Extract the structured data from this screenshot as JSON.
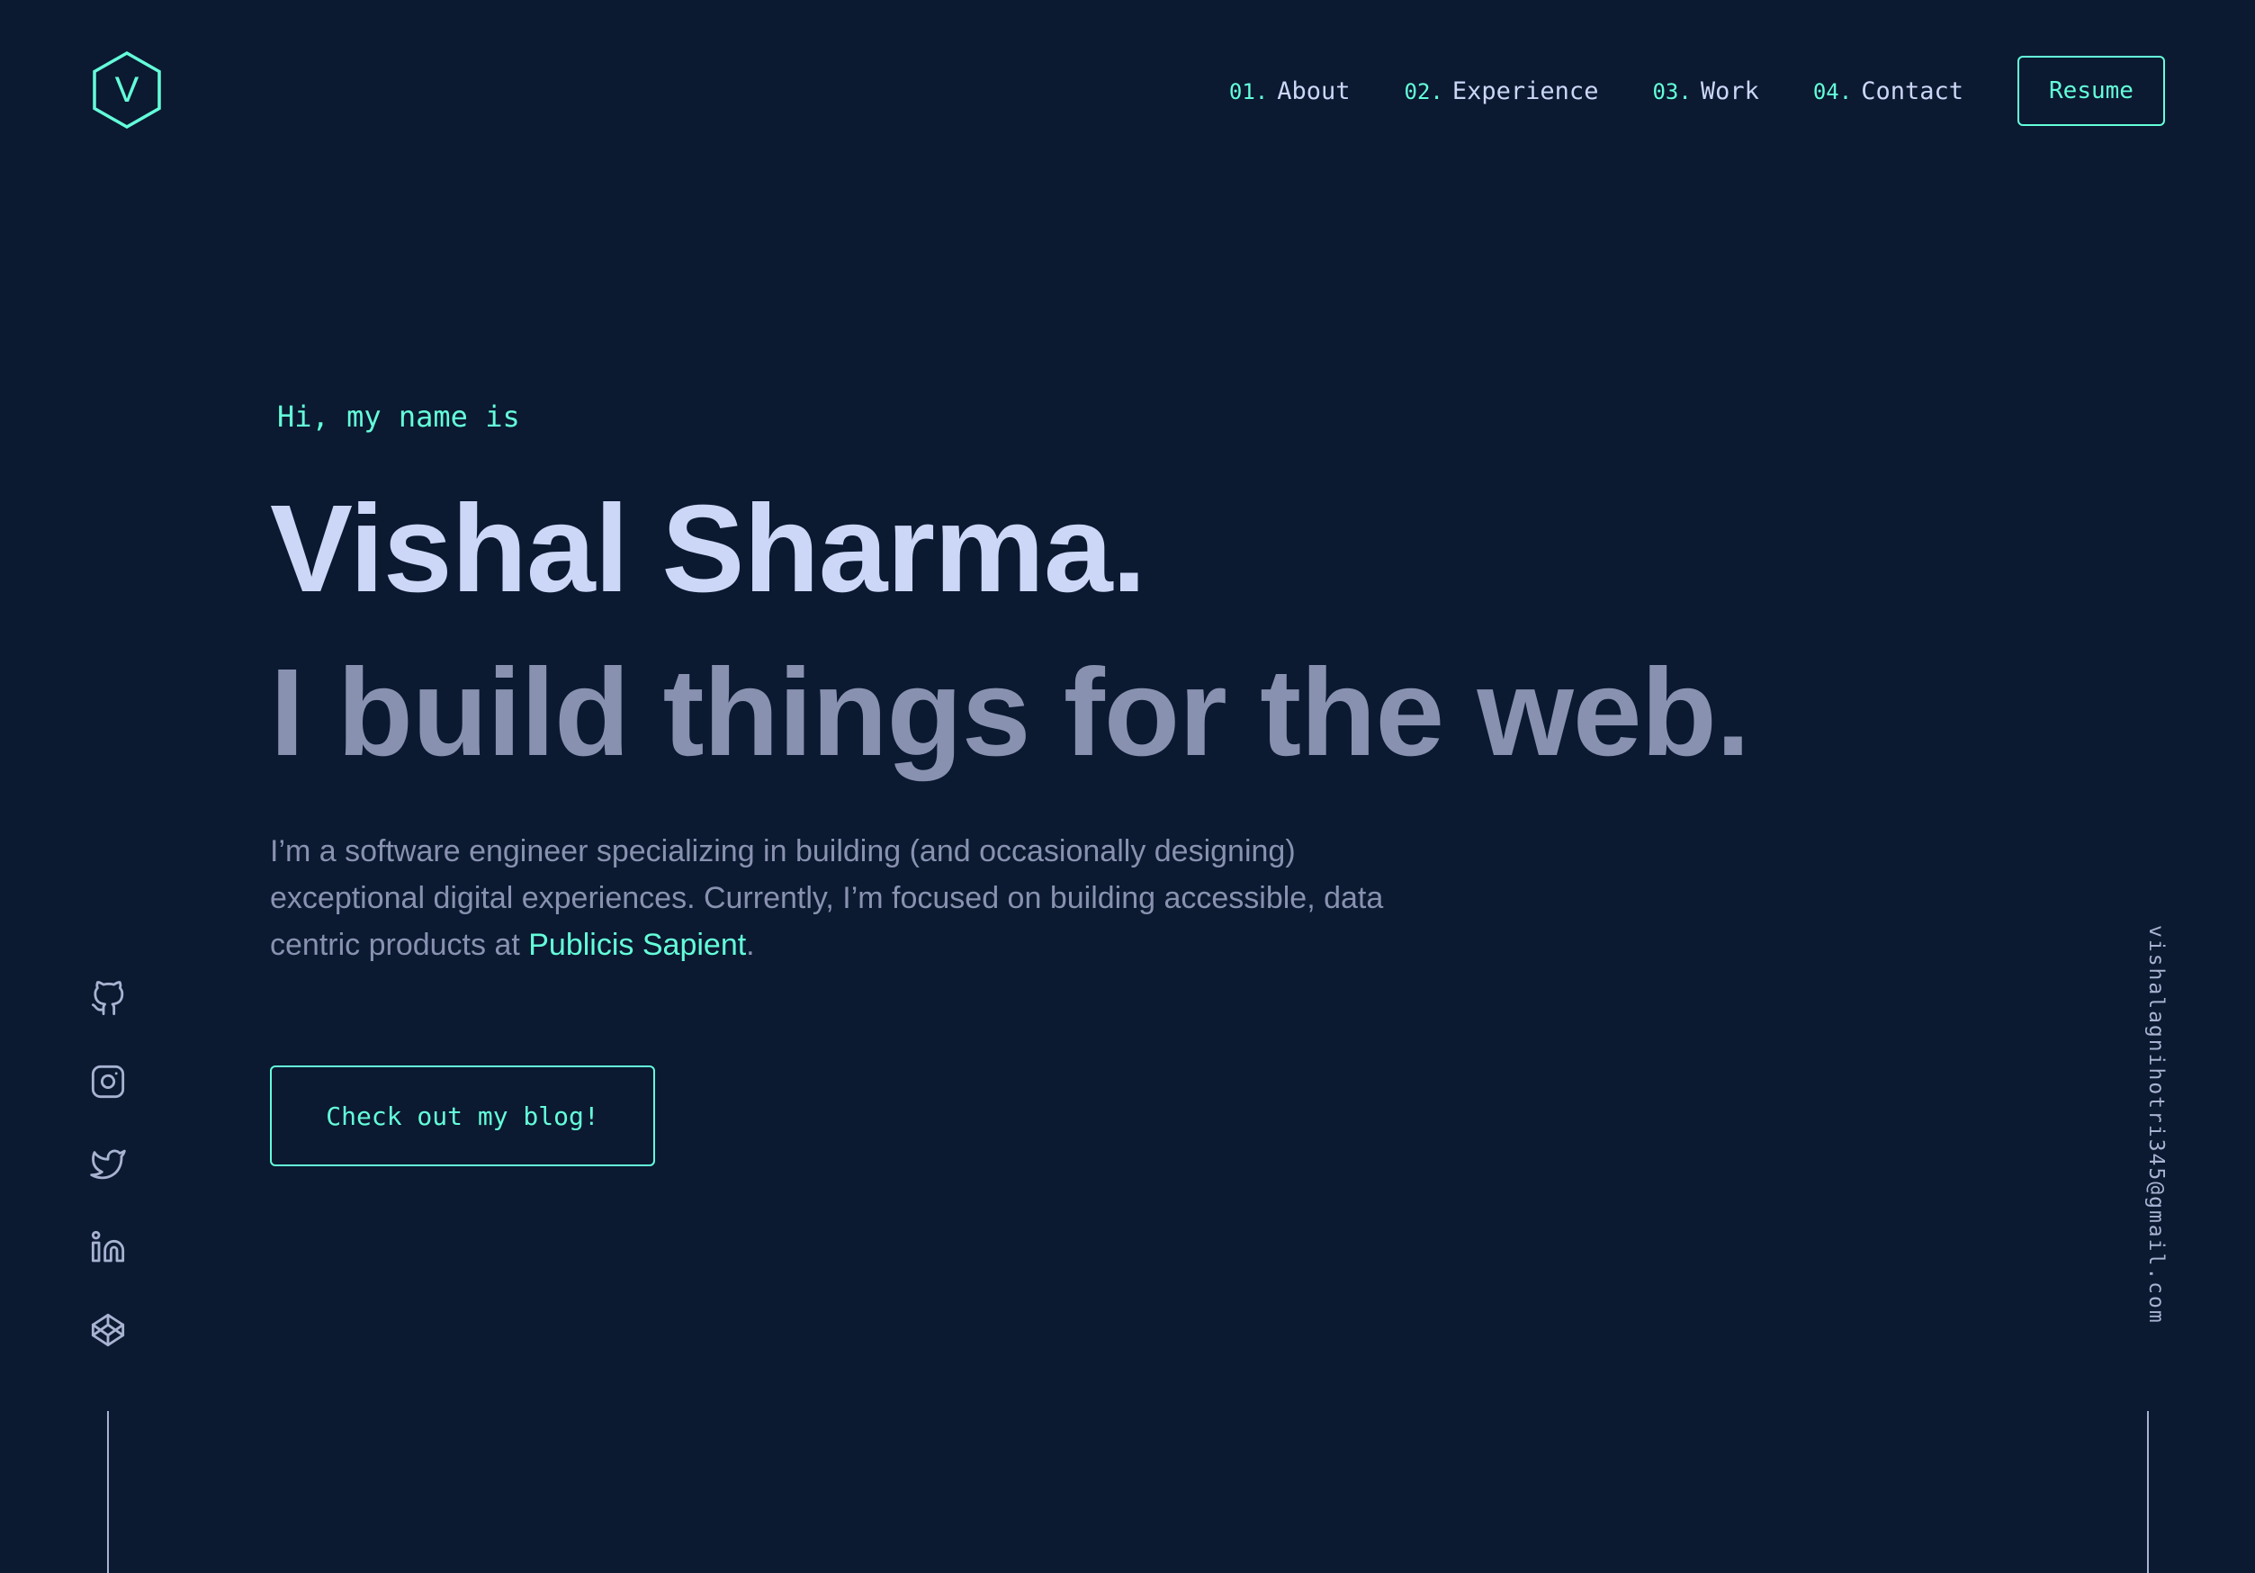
{
  "brand": {
    "logo_letter": "V",
    "accent_color": "#64ffda",
    "background_color": "#0b1931"
  },
  "nav": {
    "items": [
      {
        "num": "01.",
        "label": "About"
      },
      {
        "num": "02.",
        "label": "Experience"
      },
      {
        "num": "03.",
        "label": "Work"
      },
      {
        "num": "04.",
        "label": "Contact"
      }
    ],
    "resume_label": "Resume"
  },
  "hero": {
    "greeting": "Hi, my name is",
    "name": "Vishal Sharma.",
    "tagline": "I build things for the web.",
    "bio_before": "I’m a software engineer specializing in building (and occasionally designing) exceptional digital experiences. Currently, I’m focused on building accessible, data centric products at ",
    "bio_link": "Publicis Sapient",
    "bio_after": ".",
    "cta_label": "Check out my blog!"
  },
  "social": {
    "icons": [
      "github-icon",
      "instagram-icon",
      "twitter-icon",
      "linkedin-icon",
      "codepen-icon"
    ]
  },
  "email": "vishalagnihotri345@gmail.com"
}
